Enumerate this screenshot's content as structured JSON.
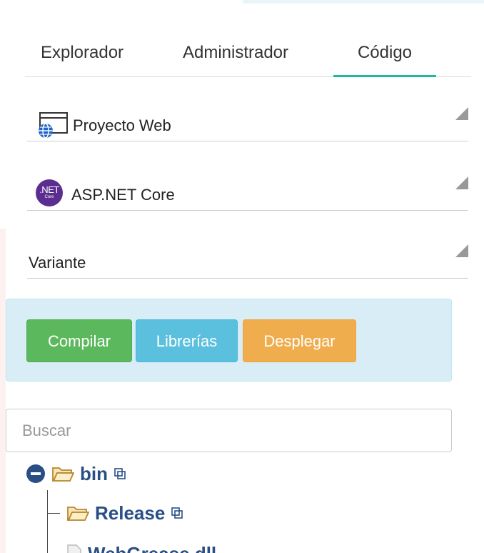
{
  "tabs": [
    {
      "label": "Explorador",
      "active": false
    },
    {
      "label": "Administrador",
      "active": false
    },
    {
      "label": "Código",
      "active": true
    }
  ],
  "selects": {
    "project_type": {
      "value": "Proyecto Web",
      "icon": "web-project-icon"
    },
    "framework": {
      "value": "ASP.NET Core",
      "icon": "dotnet-core-icon",
      "icon_text": ".NET",
      "icon_subtext": "Core"
    },
    "variant": {
      "value": "Variante"
    }
  },
  "actions": {
    "compile_label": "Compilar",
    "libraries_label": "Librerías",
    "deploy_label": "Desplegar"
  },
  "search": {
    "placeholder": "Buscar",
    "value": ""
  },
  "tree": [
    {
      "name": "bin",
      "type": "folder",
      "expanded": true,
      "depth": 0
    },
    {
      "name": "Release",
      "type": "folder",
      "depth": 1
    },
    {
      "name": "WebGrease.dll",
      "type": "file",
      "depth": 1
    }
  ],
  "colors": {
    "tab_active": "#1abc9c",
    "compile": "#5cb85c",
    "libraries": "#5bc0de",
    "deploy": "#f0ad4e",
    "panel_bg": "#d9edf7",
    "tree_text": "#2a4f85",
    "dotnet_purple": "#5c2d91"
  }
}
